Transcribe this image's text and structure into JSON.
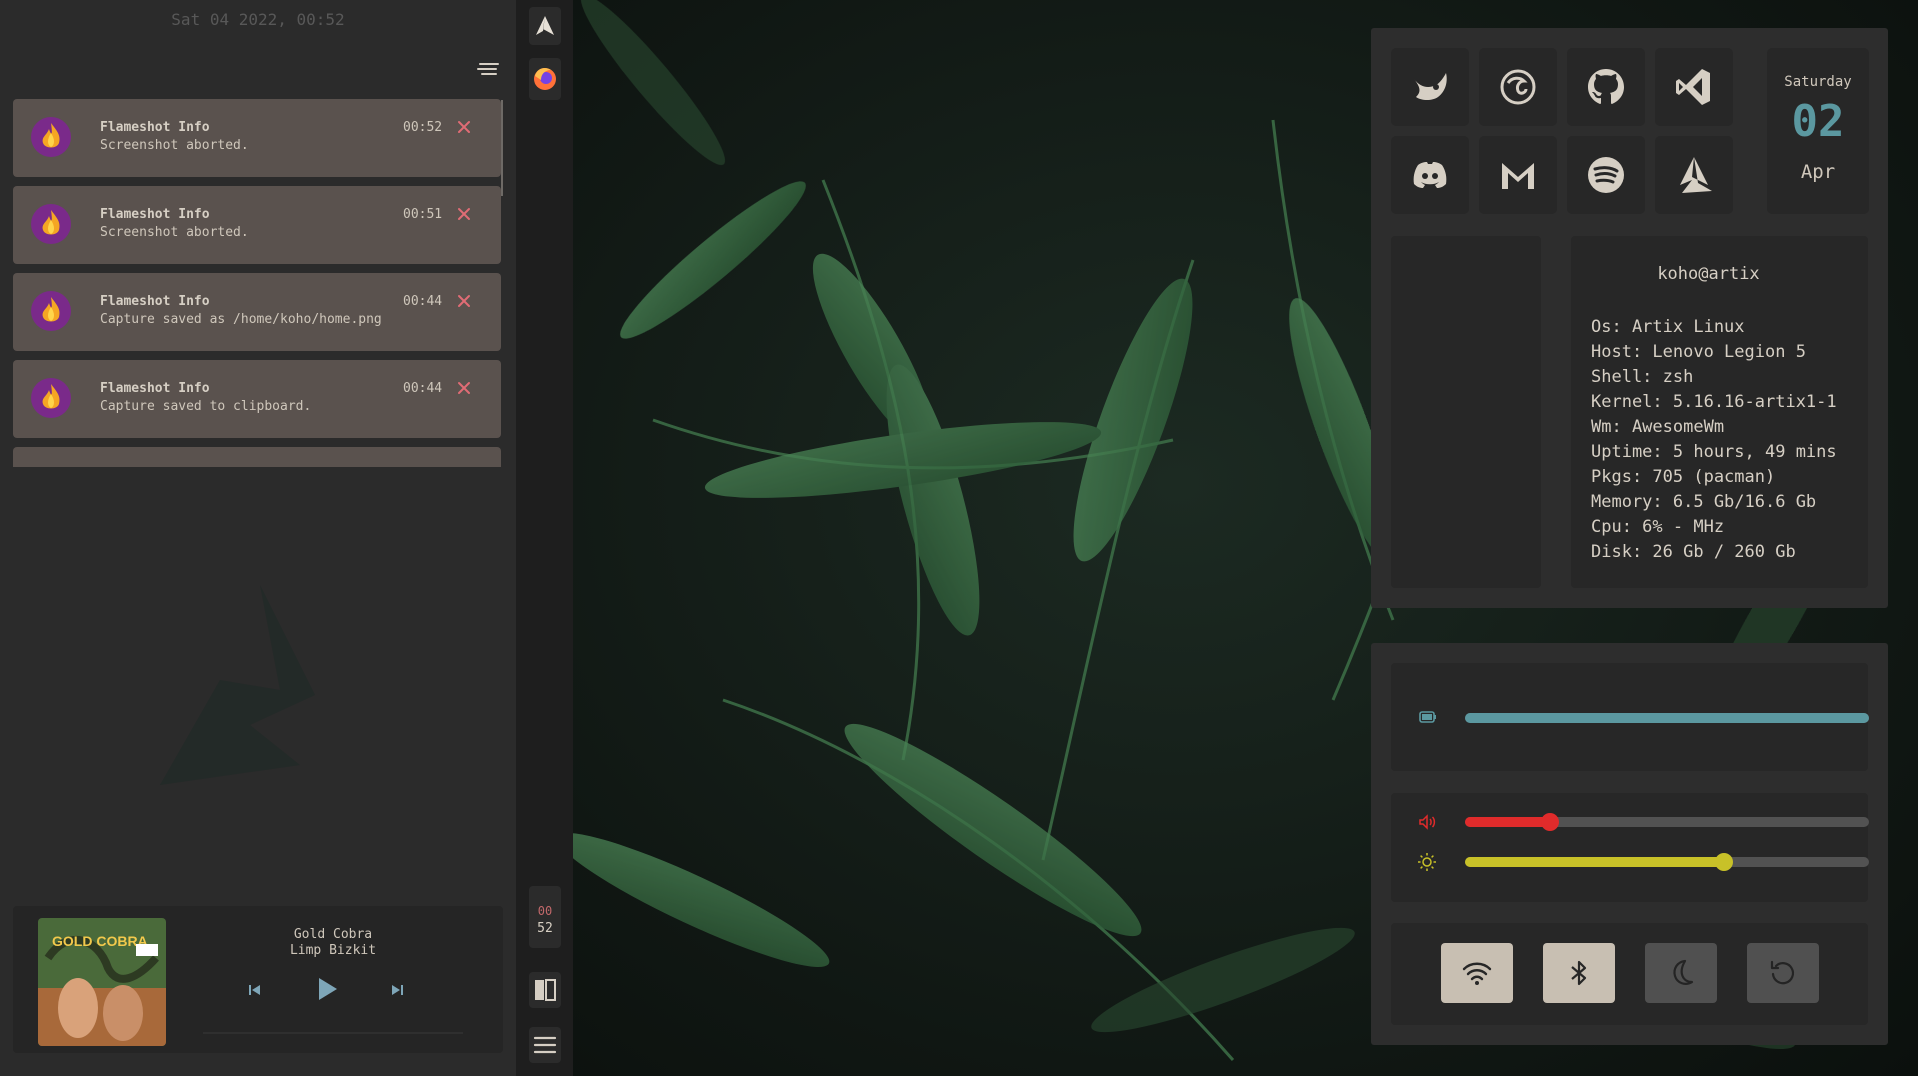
{
  "panel": {
    "datetime": "Sat 04 2022, 00:52",
    "notifications": [
      {
        "title": "Flameshot Info",
        "body": "Screenshot aborted.",
        "time": "00:52"
      },
      {
        "title": "Flameshot Info",
        "body": "Screenshot aborted.",
        "time": "00:51"
      },
      {
        "title": "Flameshot Info",
        "body": "Capture saved as /home/koho/home.png",
        "time": "00:44"
      },
      {
        "title": "Flameshot Info",
        "body": "Capture saved to clipboard.",
        "time": "00:44"
      }
    ]
  },
  "music": {
    "title": "Gold Cobra",
    "artist": "Limp Bizkit",
    "album_art_text": "GOLD COBRA",
    "icons": {
      "prev": "skip-previous-icon",
      "play": "play-icon",
      "next": "skip-next-icon"
    }
  },
  "bar": {
    "clock_hour": "00",
    "clock_minute": "52",
    "icons": [
      "artix-launcher-icon",
      "firefox-icon",
      "layout-icon",
      "menu-icon"
    ]
  },
  "apps": [
    "gimp-icon",
    "firefox-icon",
    "github-icon",
    "vscode-icon",
    "discord-icon",
    "gmail-icon",
    "spotify-icon",
    "artix-icon"
  ],
  "calendar": {
    "weekday": "Saturday",
    "day": "02",
    "month": "Apr"
  },
  "sysinfo": {
    "user": "koho@artix",
    "lines": [
      "Os: Artix Linux",
      "Host: Lenovo Legion 5",
      "Shell: zsh",
      "Kernel: 5.16.16-artix1-1",
      "Wm: AwesomeWm",
      "Uptime: 5 hours, 49 mins",
      "Pkgs: 705 (pacman)",
      "Memory: 6.5 Gb/16.6 Gb",
      "Cpu: 6% - MHz",
      "Disk: 26 Gb / 260 Gb"
    ]
  },
  "controls": {
    "battery_level": 100,
    "volume_level": 21,
    "brightness_level": 64,
    "toggles": [
      {
        "name": "wifi-toggle",
        "icon": "wifi-icon",
        "active": true
      },
      {
        "name": "bluetooth-toggle",
        "icon": "bluetooth-icon",
        "active": true
      },
      {
        "name": "night-mode-toggle",
        "icon": "moon-icon",
        "active": false
      },
      {
        "name": "reboot-toggle",
        "icon": "reboot-icon",
        "active": false
      }
    ]
  },
  "colors": {
    "accent": "#5b98a0",
    "volume": "#e02b2b",
    "brightness": "#c8c128",
    "close": "#e06c75",
    "panel_bg": "#2b2b2b",
    "card_bg": "#5a524e",
    "toggle_on": "#c8bfb2",
    "toggle_off": "#505050"
  }
}
